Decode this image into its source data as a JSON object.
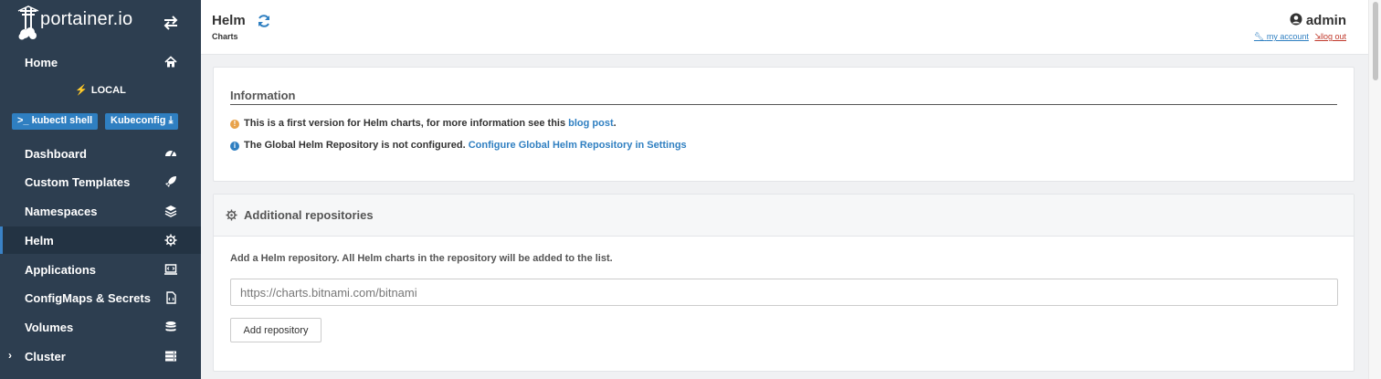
{
  "brand": {
    "name": "portainer.io"
  },
  "sidebar": {
    "home": "Home",
    "environment": "LOCAL",
    "kubectl_shell": ">_ kubectl shell",
    "kubeconfig": "Kubeconfig",
    "items": [
      {
        "label": "Dashboard",
        "icon": "tachometer-icon"
      },
      {
        "label": "Custom Templates",
        "icon": "rocket-icon"
      },
      {
        "label": "Namespaces",
        "icon": "layers-icon"
      },
      {
        "label": "Helm",
        "icon": "helm-icon",
        "active": true
      },
      {
        "label": "Applications",
        "icon": "laptop-code-icon"
      },
      {
        "label": "ConfigMaps & Secrets",
        "icon": "file-code-icon"
      },
      {
        "label": "Volumes",
        "icon": "database-icon"
      },
      {
        "label": "Cluster",
        "icon": "server-icon"
      }
    ]
  },
  "header": {
    "title": "Helm",
    "subtitle": "Charts",
    "user": "admin",
    "my_account": "my account",
    "log_out": "log out"
  },
  "information": {
    "title": "Information",
    "line1_text": "This is a first version for Helm charts, for more information see this",
    "line1_link": "blog post",
    "line1_end": ".",
    "line2_text": "The Global Helm Repository is not configured.",
    "line2_link": "Configure Global Helm Repository in Settings"
  },
  "repositories": {
    "title": "Additional repositories",
    "description": "Add a Helm repository. All Helm charts in the repository will be added to the list.",
    "placeholder": "https://charts.bitnami.com/bitnami",
    "add_button": "Add repository"
  },
  "colors": {
    "sidebar": "#2d3e50",
    "accent": "#2f7fc1",
    "warning": "#e8a24a",
    "logout": "#c0392b"
  }
}
